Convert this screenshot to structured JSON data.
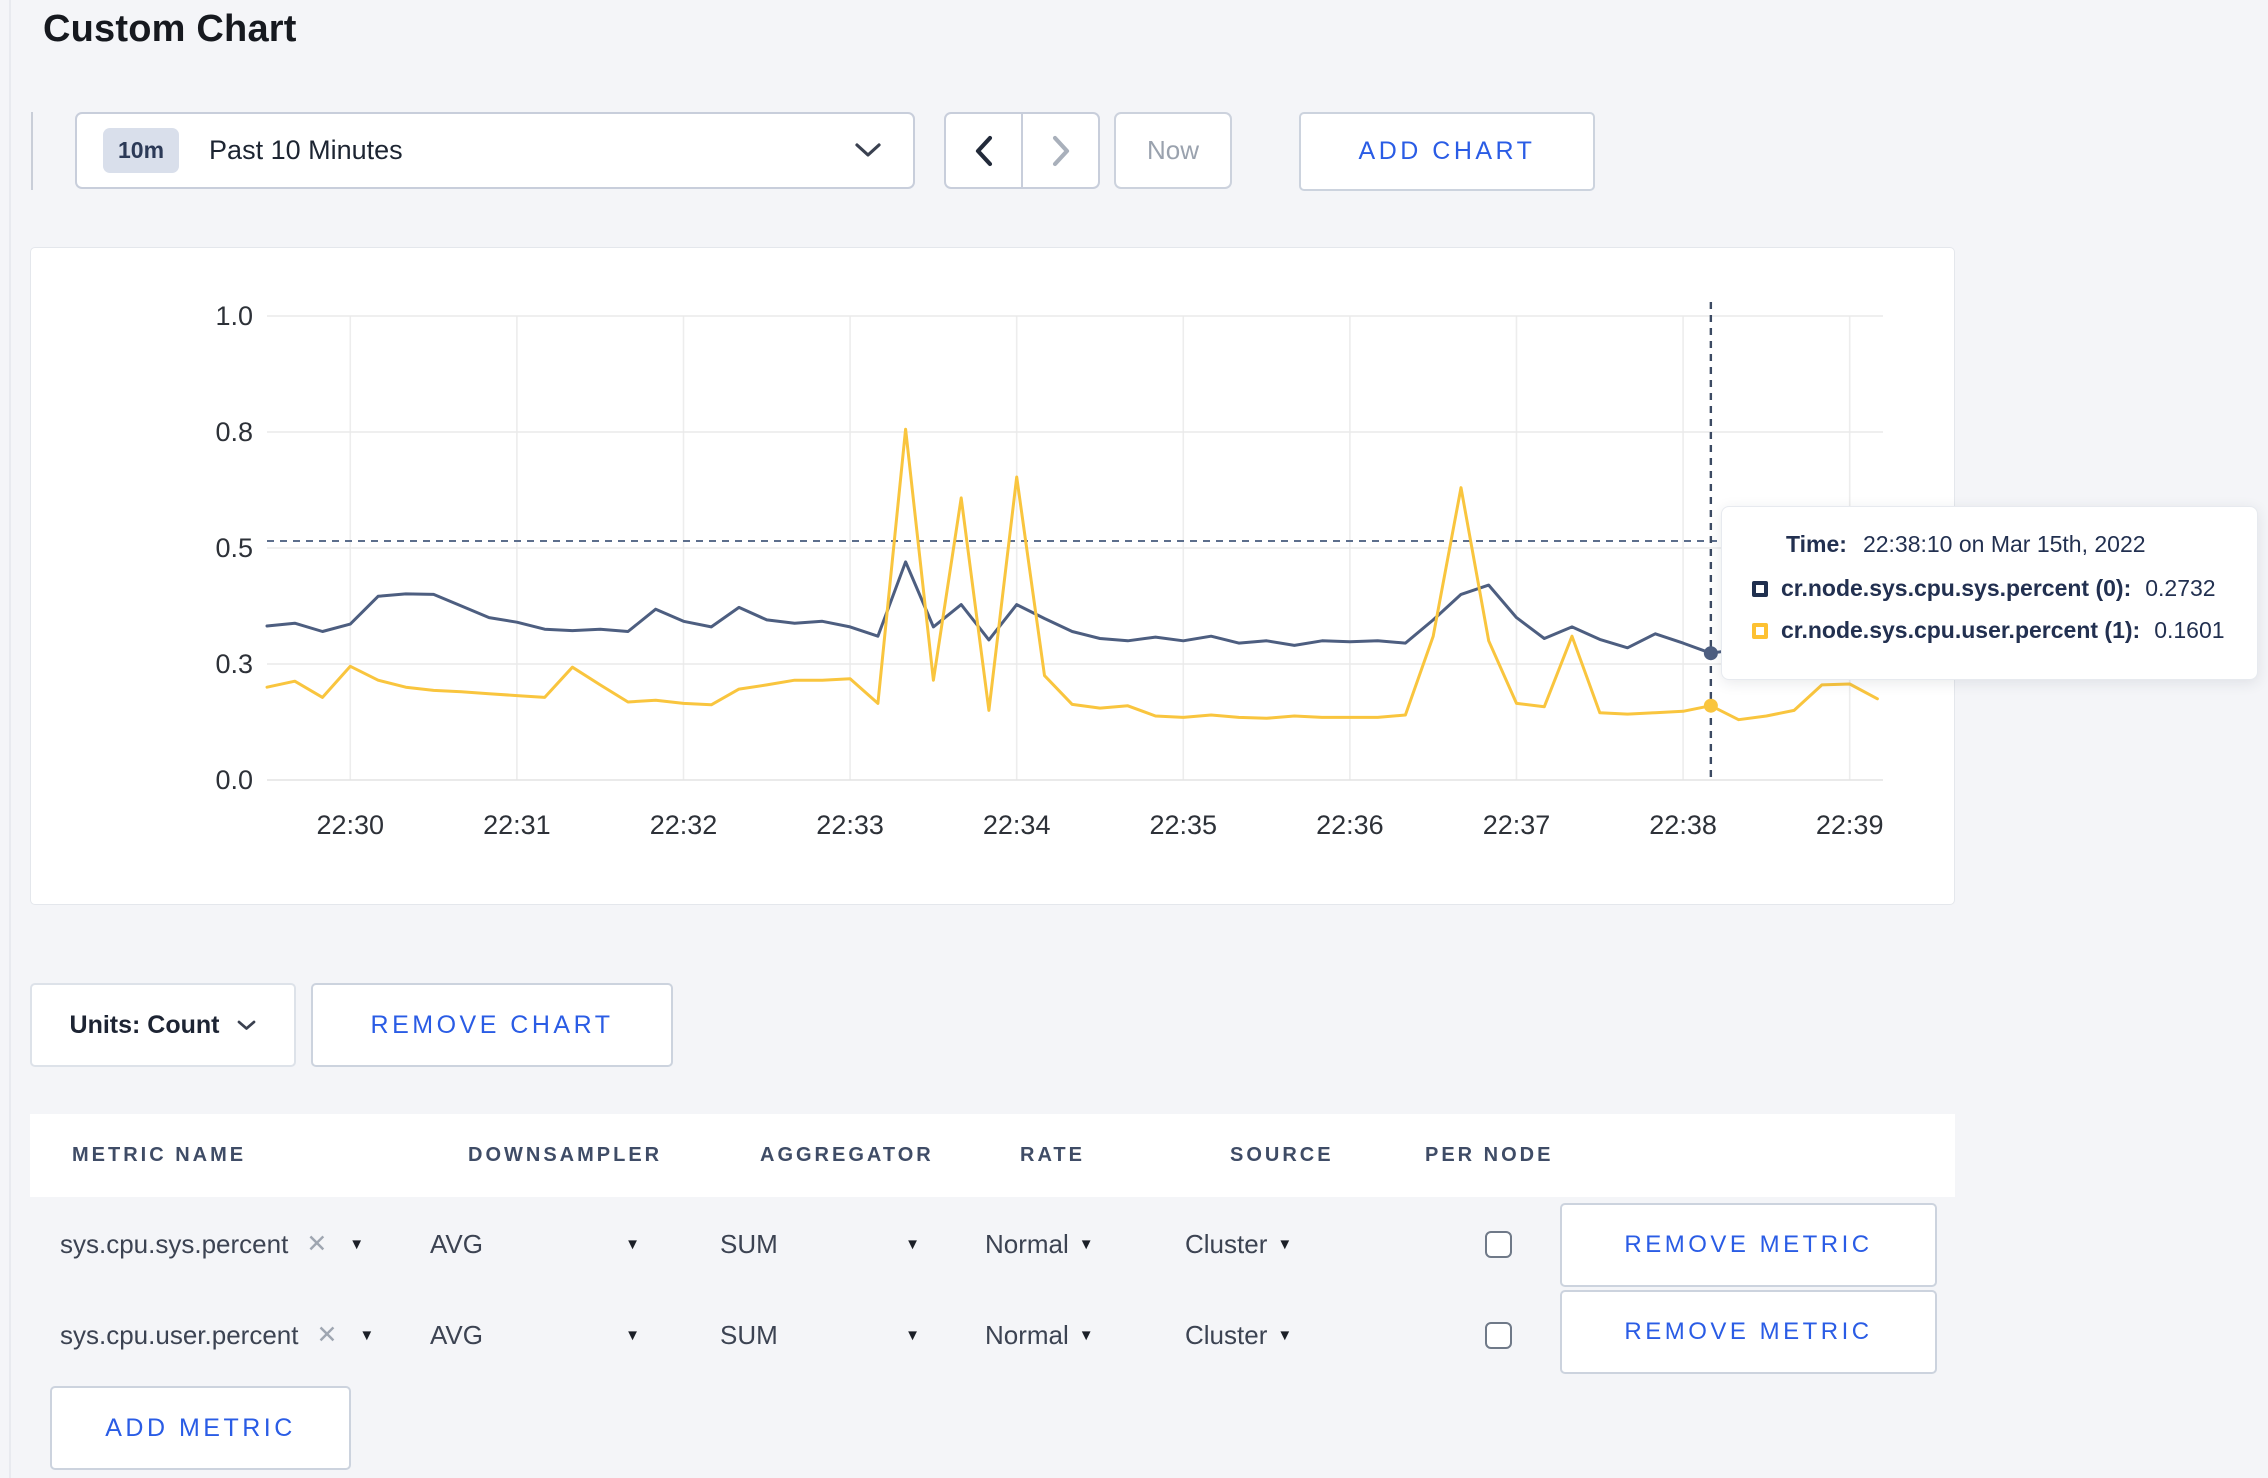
{
  "page": {
    "title": "Custom Chart"
  },
  "toolbar": {
    "range_badge": "10m",
    "range_label": "Past 10 Minutes",
    "prev_label": "previous time window",
    "next_label": "next time window",
    "now_label": "Now",
    "add_chart_label": "ADD CHART"
  },
  "icons": {
    "chevron_down": "v",
    "chevron_left": "<",
    "chevron_right": ">",
    "clear_metric": "✕",
    "select_arrow": "▼"
  },
  "chart_controls": {
    "units_label": "Units: Count",
    "remove_chart_label": "REMOVE CHART"
  },
  "chart_data": {
    "type": "line",
    "xlabel": "",
    "ylabel": "",
    "ylim": [
      0,
      1
    ],
    "grid": true,
    "x_tick_minutes": [
      0,
      1,
      2,
      3,
      4,
      5,
      6,
      7,
      8,
      9
    ],
    "x_ticks": [
      "22:30",
      "22:31",
      "22:32",
      "22:33",
      "22:34",
      "22:35",
      "22:36",
      "22:37",
      "22:38",
      "22:39"
    ],
    "y_ticks": [
      {
        "label": "0.0",
        "value": 0.0
      },
      {
        "label": "0.3",
        "value": 0.25
      },
      {
        "label": "0.5",
        "value": 0.5
      },
      {
        "label": "0.8",
        "value": 0.75
      },
      {
        "label": "1.0",
        "value": 1.0
      }
    ],
    "x_start_minutes": -0.5,
    "sample_interval_minutes": 0.16667,
    "series": [
      {
        "name": "cr.node.sys.cpu.sys.percent",
        "color": "#4d5e80",
        "values": [
          0.332,
          0.338,
          0.32,
          0.336,
          0.396,
          0.401,
          0.4,
          0.375,
          0.35,
          0.34,
          0.325,
          0.322,
          0.325,
          0.32,
          0.368,
          0.342,
          0.33,
          0.372,
          0.345,
          0.338,
          0.342,
          0.33,
          0.31,
          0.47,
          0.33,
          0.378,
          0.302,
          0.378,
          0.348,
          0.32,
          0.305,
          0.3,
          0.308,
          0.3,
          0.31,
          0.295,
          0.3,
          0.29,
          0.3,
          0.298,
          0.3,
          0.295,
          0.345,
          0.4,
          0.42,
          0.35,
          0.305,
          0.33,
          0.303,
          0.285,
          0.315,
          0.295,
          0.2732,
          0.282,
          0.27,
          0.31,
          0.305,
          0.298,
          0.303
        ]
      },
      {
        "name": "cr.node.sys.cpu.user.percent",
        "color": "#f9c53e",
        "values": [
          0.2,
          0.213,
          0.178,
          0.245,
          0.215,
          0.2,
          0.193,
          0.19,
          0.186,
          0.182,
          0.178,
          0.243,
          0.205,
          0.168,
          0.172,
          0.165,
          0.162,
          0.196,
          0.205,
          0.215,
          0.215,
          0.218,
          0.165,
          0.756,
          0.215,
          0.608,
          0.15,
          0.653,
          0.225,
          0.163,
          0.155,
          0.16,
          0.138,
          0.135,
          0.14,
          0.135,
          0.133,
          0.138,
          0.135,
          0.135,
          0.135,
          0.14,
          0.31,
          0.63,
          0.3,
          0.165,
          0.158,
          0.31,
          0.145,
          0.142,
          0.145,
          0.148,
          0.1601,
          0.13,
          0.138,
          0.15,
          0.205,
          0.207,
          0.175
        ]
      }
    ],
    "hover": {
      "time_prefix": "Time:",
      "time_label": "22:38:10 on Mar 15th, 2022",
      "x_minutes": 8.1667,
      "cursor_value": 0.515,
      "rows": [
        {
          "swatch_color": "#20304f",
          "label": "cr.node.sys.cpu.sys.percent (0):",
          "value": "0.2732",
          "point_value": 0.2732
        },
        {
          "swatch_color": "#fdc132",
          "label": "cr.node.sys.cpu.user.percent (1):",
          "value": "0.1601",
          "point_value": 0.1601
        }
      ]
    }
  },
  "metrics_table": {
    "headers": [
      "METRIC NAME",
      "DOWNSAMPLER",
      "AGGREGATOR",
      "RATE",
      "SOURCE",
      "PER NODE"
    ],
    "rows": [
      {
        "metric": "sys.cpu.sys.percent",
        "downsampler": "AVG",
        "aggregator": "SUM",
        "rate": "Normal",
        "source": "Cluster",
        "per_node_checked": false,
        "remove_label": "REMOVE METRIC"
      },
      {
        "metric": "sys.cpu.user.percent",
        "downsampler": "AVG",
        "aggregator": "SUM",
        "rate": "Normal",
        "source": "Cluster",
        "per_node_checked": false,
        "remove_label": "REMOVE METRIC"
      }
    ],
    "add_metric_label": "ADD METRIC"
  }
}
